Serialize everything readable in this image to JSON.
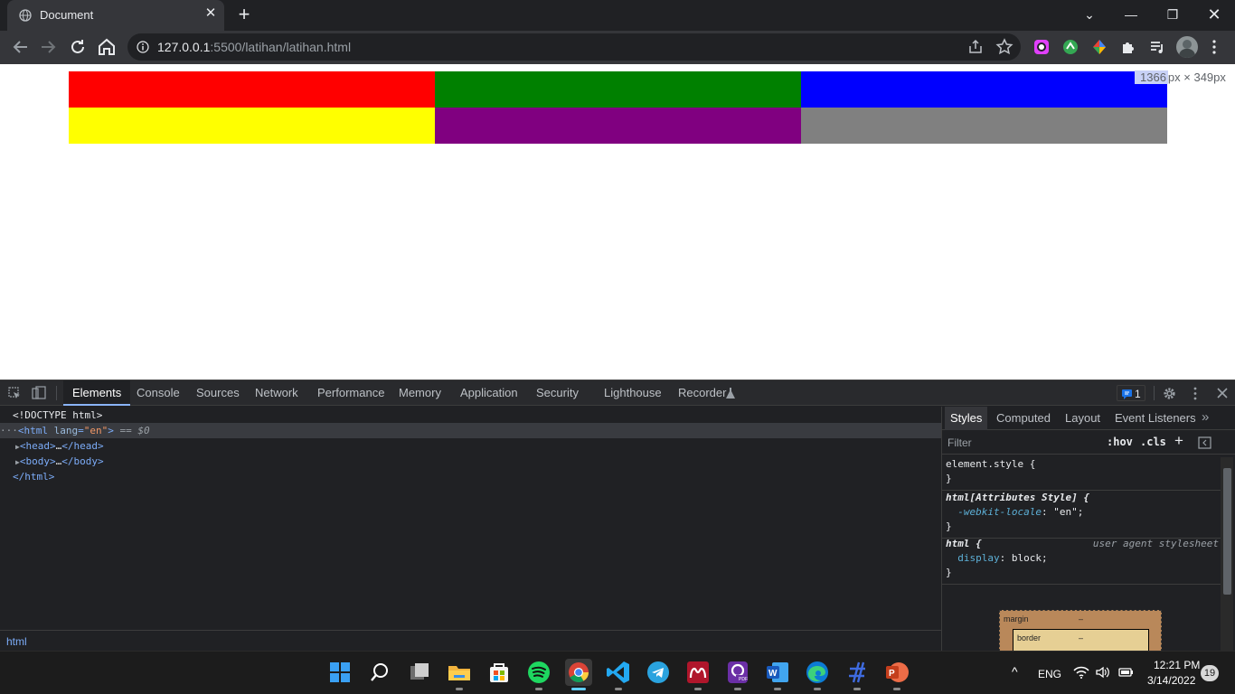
{
  "browser": {
    "tab_title": "Document",
    "new_tab_symbol": "+",
    "url_host": "127.0.0.1",
    "url_rest": ":5500/latihan/latihan.html"
  },
  "viewport": {
    "size_badge_hl": "1366",
    "size_badge_rest": "px × 349px",
    "boxes": [
      {
        "color": "#ff0000"
      },
      {
        "color": "#008000"
      },
      {
        "color": "#0000ff"
      },
      {
        "color": "#ffff00"
      },
      {
        "color": "#800080"
      },
      {
        "color": "#808080"
      }
    ]
  },
  "devtools": {
    "tabs": [
      "Elements",
      "Console",
      "Sources",
      "Network",
      "Performance",
      "Memory",
      "Application",
      "Security",
      "Lighthouse",
      "Recorder"
    ],
    "issues_count": "1",
    "dom": {
      "doctype": "<!DOCTYPE html>",
      "html_open": "<html",
      "lang_attr": "lang",
      "lang_val": "\"en\"",
      "html_close_bracket": ">",
      "selected_marker": " == $0",
      "head": "<head>",
      "head_ellipsis": "…",
      "head_close": "</head>",
      "body": "<body>",
      "body_ellipsis": "…",
      "body_close": "</body>",
      "html_end": "</html>"
    },
    "breadcrumb": "html",
    "styles_tabs": [
      "Styles",
      "Computed",
      "Layout",
      "Event Listeners"
    ],
    "filter_placeholder": "Filter",
    "hov": ":hov",
    "cls": ".cls",
    "rules": {
      "element_style": "element.style {",
      "close": "}",
      "attr_selector": "html[Attributes Style] {",
      "attr_prop": "-webkit-locale",
      "attr_val": ": \"en\";",
      "html_selector": "html {",
      "ua_source": "user agent stylesheet",
      "display_prop": "display",
      "display_val": ": block;"
    },
    "boxmodel": {
      "margin": "margin",
      "margin_val": "–",
      "border": "border",
      "border_val": "–"
    }
  },
  "taskbar": {
    "lang": "ENG",
    "time": "12:21 PM",
    "date": "3/14/2022",
    "notifications": "19"
  }
}
